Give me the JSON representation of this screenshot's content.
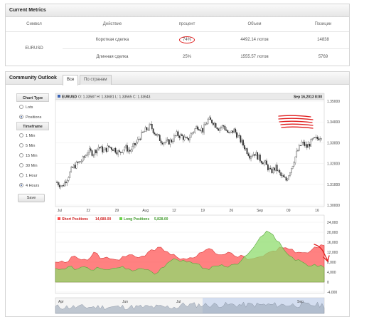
{
  "metrics": {
    "title": "Current Metrics",
    "columns": [
      "Символ",
      "Действие",
      "процент",
      "Объем",
      "Позиции"
    ],
    "symbol": "EURUSD",
    "rows": [
      {
        "action": "Короткая сделка",
        "percent": "74%",
        "volume": "4492.14 лотов",
        "positions": "14838"
      },
      {
        "action": "Длинная сделка",
        "percent": "25%",
        "volume": "1555.57 лотов",
        "positions": "5769"
      }
    ]
  },
  "outlook": {
    "title": "Community Outlook",
    "tabs": [
      "Все",
      "По странам"
    ],
    "chart_type_header": "Chart Type",
    "chart_types": [
      "Lots",
      "Positions"
    ],
    "chart_type_selected": "Positions",
    "timeframe_header": "Timeframe",
    "timeframes": [
      "1 Min",
      "5 Min",
      "15 Min",
      "30 Min",
      "1 Hour",
      "4 Hours"
    ],
    "timeframe_selected": "4 Hours",
    "save_label": "Save"
  },
  "chart_data": [
    {
      "type": "candlestick",
      "symbol_label": "EURUSD",
      "ohlc_text": "O: 1.33587 H: 1.33681 L: 1.33565 C: 1.33643",
      "date_label": "Sep 16,2013 8:00",
      "ylim": [
        1.3,
        1.35
      ],
      "y_ticks": [
        "1.35000",
        "1.34000",
        "1.33000",
        "1.32000",
        "1.31000",
        "1.30000"
      ],
      "x_ticks": [
        "Jul",
        "22",
        "29",
        "Aug",
        "12",
        "19",
        "26",
        "Sep",
        "09",
        "16"
      ],
      "close_path": [
        1.311,
        1.309,
        1.313,
        1.318,
        1.32,
        1.322,
        1.326,
        1.325,
        1.328,
        1.326,
        1.328,
        1.327,
        1.325,
        1.328,
        1.326,
        1.329,
        1.333,
        1.336,
        1.338,
        1.334,
        1.331,
        1.33,
        1.331,
        1.334,
        1.333,
        1.331,
        1.335,
        1.338,
        1.336,
        1.341,
        1.34,
        1.337,
        1.338,
        1.334,
        1.336,
        1.332,
        1.328,
        1.324,
        1.325,
        1.322,
        1.32,
        1.316,
        1.318,
        1.314,
        1.312,
        1.318,
        1.325,
        1.33,
        1.328,
        1.331,
        1.332,
        1.334
      ]
    },
    {
      "type": "area",
      "series": [
        {
          "name": "Short Positions",
          "value_label": "14,680.00",
          "color": "#ff6b6b"
        },
        {
          "name": "Long Positions",
          "value_label": "5,828.00",
          "color": "#8fdc6e"
        }
      ],
      "ylim": [
        -4000,
        24000
      ],
      "y_ticks": [
        "24,000",
        "20,000",
        "16,000",
        "12,000",
        "8,000",
        "4,000",
        "0",
        "-4,000"
      ],
      "short_values": [
        8000,
        8500,
        8200,
        10500,
        9000,
        8800,
        12000,
        9500,
        10000,
        9200,
        8800,
        10200,
        11000,
        9800,
        10500,
        13000,
        14000,
        12500,
        11000,
        10000,
        9500,
        9800,
        10200,
        12000,
        13500,
        11500,
        11000,
        12000,
        10500,
        10800,
        9000,
        9500,
        10200,
        11500,
        12500,
        14000,
        13800,
        13200,
        12000,
        11800,
        12800,
        13800,
        14680
      ],
      "long_values": [
        5500,
        5200,
        6200,
        5000,
        6000,
        5800,
        4800,
        5500,
        5000,
        5600,
        5800,
        5200,
        4500,
        5400,
        5000,
        4200,
        3800,
        6000,
        8500,
        9000,
        8800,
        8200,
        7500,
        5500,
        5000,
        6500,
        7000,
        6000,
        7200,
        8500,
        11000,
        14000,
        18000,
        20500,
        19000,
        16000,
        12000,
        10000,
        9000,
        7500,
        6500,
        6200,
        5828
      ]
    },
    {
      "type": "navigator",
      "x_ticks": [
        "Apr",
        "Jun",
        "Jul",
        "Sep"
      ]
    }
  ],
  "annotations": {
    "color": "#e01e1e"
  }
}
